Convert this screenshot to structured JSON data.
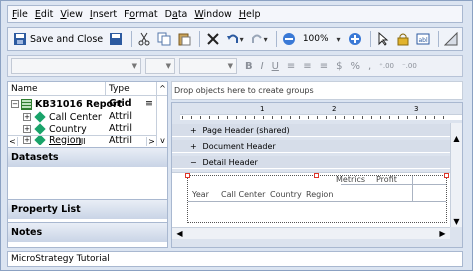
{
  "menu": {
    "items": [
      {
        "u": "F",
        "rest": "ile"
      },
      {
        "u": "E",
        "rest": "dit"
      },
      {
        "u": "V",
        "rest": "iew"
      },
      {
        "u": "I",
        "rest": "nsert"
      },
      {
        "u": "",
        "pre": "F",
        "mid": "o",
        "rest": "rmat"
      },
      {
        "u": "",
        "pre": "D",
        "mid": "a",
        "rest": "ta"
      },
      {
        "u": "W",
        "rest": "indow"
      },
      {
        "u": "H",
        "rest": "elp"
      }
    ]
  },
  "toolbar": {
    "save_close_label": "Save and Close",
    "zoom_value": "100%"
  },
  "format_bar": {
    "bold": "B",
    "italic": "I",
    "underline": "U",
    "currency": "$",
    "percent": "%",
    "comma": ",",
    "inc_decimal": "⁺.00",
    "dec_decimal": "⁻.00"
  },
  "objects": {
    "col_name": "Name",
    "col_type": "Type",
    "rows": [
      {
        "name": "KB31016 Report",
        "type": "Grid"
      },
      {
        "name": "Call Center",
        "type": "Attril"
      },
      {
        "name": "Country",
        "type": "Attril"
      },
      {
        "name": "Region",
        "type": "Attril"
      }
    ],
    "scroll_thumb": "III"
  },
  "sections": {
    "datasets": "Datasets",
    "property_list": "Property List",
    "notes": "Notes"
  },
  "layout": {
    "drop_hint": "Drop objects here to create groups",
    "ruler_numbers": [
      "1",
      "2",
      "3"
    ],
    "bands": [
      "Page Header (shared)",
      "Document Header",
      "Detail Header"
    ],
    "band_markers": [
      "+",
      "+",
      "−"
    ],
    "grid_top_headers": [
      "Metrics",
      "Profit"
    ],
    "grid_row_headers": [
      "Year",
      "Call Center",
      "Country",
      "Region"
    ]
  },
  "status": {
    "text": "MicroStrategy Tutorial"
  },
  "colors": {
    "window_bg": "#dbe4f1",
    "attribute_green": "#1aa36a",
    "handle_red": "#e0362a"
  }
}
